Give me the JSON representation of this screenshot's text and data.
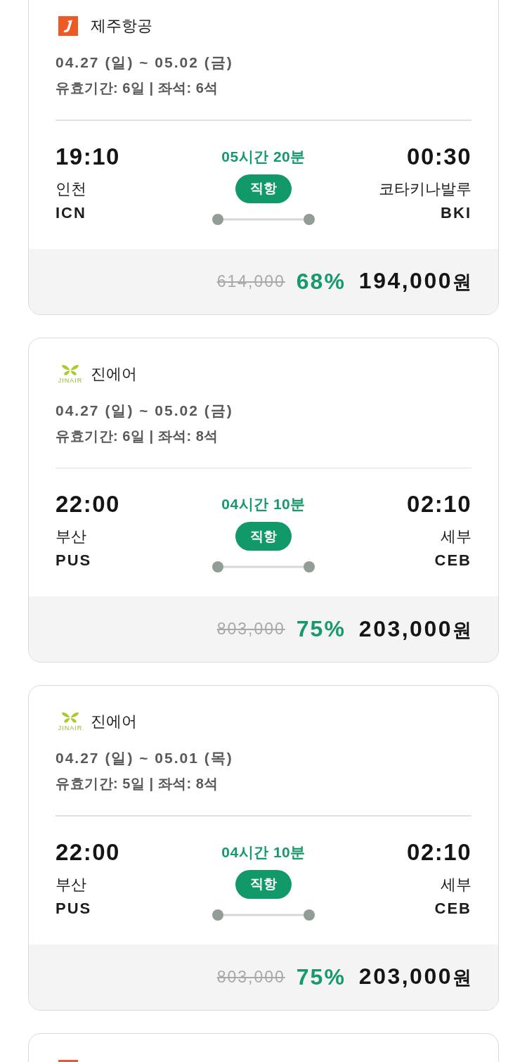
{
  "flights": [
    {
      "airline": {
        "kind": "jeju",
        "name": "제주항공"
      },
      "dates": "04.27 (일) ~ 05.02 (금)",
      "validity": "유효기간: 6일 | 좌석: 6석",
      "departure": {
        "time": "19:10",
        "city": "인천",
        "code": "ICN"
      },
      "duration": "05시간 20분",
      "route_type": "직항",
      "arrival": {
        "time": "00:30",
        "city": "코타키나발루",
        "code": "BKI"
      },
      "price": {
        "original": "614,000",
        "discount": "68%",
        "final": "194,000",
        "currency": "원"
      }
    },
    {
      "airline": {
        "kind": "jinair",
        "logo_text": "JINAIR",
        "name": "진에어"
      },
      "dates": "04.27 (일) ~ 05.02 (금)",
      "validity": "유효기간: 6일 | 좌석: 8석",
      "departure": {
        "time": "22:00",
        "city": "부산",
        "code": "PUS"
      },
      "duration": "04시간 10분",
      "route_type": "직항",
      "arrival": {
        "time": "02:10",
        "city": "세부",
        "code": "CEB"
      },
      "price": {
        "original": "803,000",
        "discount": "75%",
        "final": "203,000",
        "currency": "원"
      }
    },
    {
      "airline": {
        "kind": "jinair",
        "logo_text": "JINAIR",
        "name": "진에어"
      },
      "dates": "04.27 (일) ~ 05.01 (목)",
      "validity": "유효기간: 5일 | 좌석: 8석",
      "departure": {
        "time": "22:00",
        "city": "부산",
        "code": "PUS"
      },
      "duration": "04시간 10분",
      "route_type": "직항",
      "arrival": {
        "time": "02:10",
        "city": "세부",
        "code": "CEB"
      },
      "price": {
        "original": "803,000",
        "discount": "75%",
        "final": "203,000",
        "currency": "원"
      }
    },
    {
      "airline": {
        "kind": "jeju"
      }
    }
  ]
}
